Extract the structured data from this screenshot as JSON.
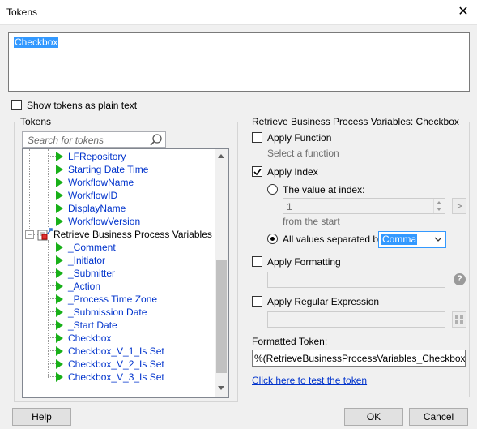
{
  "window": {
    "title": "Tokens",
    "close_glyph": "✕"
  },
  "token_text": "Checkbox",
  "plain_text_option": {
    "label": "Show tokens as plain text",
    "checked": false
  },
  "tokens_panel": {
    "title": "Tokens",
    "search_placeholder": "Search for tokens",
    "items": [
      {
        "label": "LFRepository"
      },
      {
        "label": "Starting Date Time"
      },
      {
        "label": "WorkflowName"
      },
      {
        "label": "WorkflowID"
      },
      {
        "label": "DisplayName"
      },
      {
        "label": "WorkflowVersion"
      }
    ],
    "group_node": {
      "label": "Retrieve Business Process Variables",
      "expander": "⊟"
    },
    "group_items": [
      {
        "label": "_Comment"
      },
      {
        "label": "_Initiator"
      },
      {
        "label": "_Submitter"
      },
      {
        "label": "_Action"
      },
      {
        "label": "_Process Time Zone"
      },
      {
        "label": "_Submission Date"
      },
      {
        "label": "_Start Date"
      },
      {
        "label": "Checkbox"
      },
      {
        "label": "Checkbox_V_1_Is Set"
      },
      {
        "label": "Checkbox_V_2_Is Set"
      },
      {
        "label": "Checkbox_V_3_Is Set"
      }
    ]
  },
  "details_panel": {
    "title": "Retrieve Business Process Variables: Checkbox",
    "apply_function": {
      "label": "Apply Function",
      "checked": false,
      "hint": "Select a function"
    },
    "apply_index": {
      "label": "Apply Index",
      "checked": true,
      "value_at_index": {
        "label": "The value at index:",
        "selected": false,
        "value": "1",
        "go": ">",
        "hint": "from the  start"
      },
      "all_values": {
        "label": "All values separated by:",
        "selected": true,
        "separator": "Comma"
      }
    },
    "apply_formatting": {
      "label": "Apply Formatting",
      "checked": false,
      "help": "?"
    },
    "apply_regex": {
      "label": "Apply Regular Expression",
      "checked": false
    },
    "formatted_token": {
      "label": "Formatted Token:",
      "value": "%(RetrieveBusinessProcessVariables_Checkbox#[, ]#)"
    },
    "test_link": "Click here to test the token"
  },
  "footer": {
    "help": "Help",
    "ok": "OK",
    "cancel": "Cancel"
  },
  "colors": {
    "selection": "#3399ff",
    "token_text": "#0033cc",
    "arrow_green": "#18b018"
  }
}
